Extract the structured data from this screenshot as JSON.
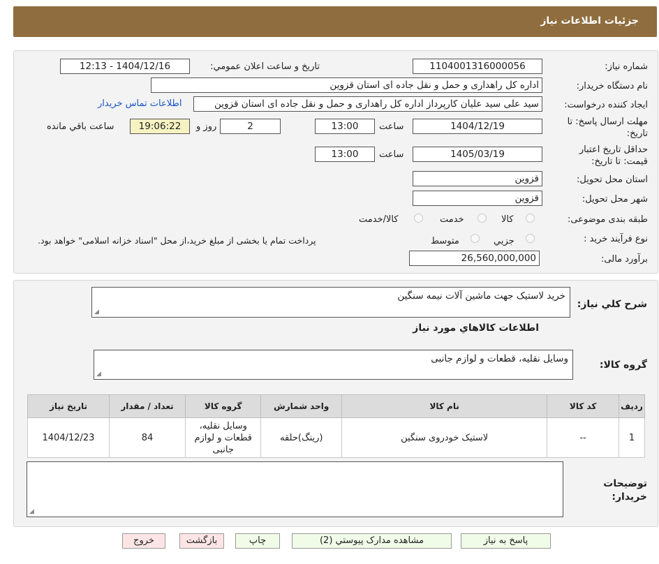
{
  "header": {
    "title": "جزئیات اطلاعات نیاز"
  },
  "form": {
    "need_number_label": "شماره نیاز:",
    "need_number": "1104001316000056",
    "announce_label": "تاریخ و ساعت اعلان عمومي:",
    "announce_value": "1404/12/16 - 12:13",
    "buyer_org_label": "نام دستگاه خريدار:",
    "buyer_org": "اداره کل راهداری و حمل و نقل جاده ای استان قزوین",
    "requester_label": "ايجاد کننده درخواست:",
    "requester": "سید علی سید علیان کارپرداز اداره کل راهداری و حمل و نقل جاده ای استان قزوین",
    "contact_link": "اطلاعات تماس خريدار",
    "deadline_label": "مهلت ارسال پاسخ: تا تاریخ:",
    "deadline_date": "1404/12/19",
    "time_label": "ساعت",
    "deadline_time": "13:00",
    "days": "2",
    "days_label": "روز و",
    "remaining_time": "19:06:22",
    "remaining_label": "ساعت باقي مانده",
    "validity_label": "حداقل تاريخ اعتبار قيمت: تا تاریخ:",
    "validity_date": "1405/03/19",
    "validity_time": "13:00",
    "province_label": "استان محل تحويل:",
    "province": "قزوين",
    "city_label": "شهر محل تحويل:",
    "city": "قزوين",
    "category_label": "طبقه بندی موضوعی:",
    "category_options": [
      "کالا",
      "خدمت",
      "کالا/خدمت"
    ],
    "process_label": "نوع فرآيند خريد :",
    "process_options": [
      "جزيي",
      "متوسط"
    ],
    "process_note": "پرداخت تمام یا بخشی از مبلغ خرید،از محل \"اسناد خزانه اسلامی\" خواهد بود.",
    "budget_label": "برآورد مالی:",
    "budget": "26,560,000,000"
  },
  "description": {
    "label": "شرح کلي نياز:",
    "value": "خرید لاستیک جهت ماشین آلات نیمه سنگین"
  },
  "goods": {
    "section_title": "اطلاعات کالاهاي مورد نياز",
    "group_label": "گروه کالا:",
    "group_value": "وسایل نقلیه، قطعات و لوازم جانبی",
    "columns": [
      "رديف",
      "کد کالا",
      "نام کالا",
      "واحد شمارش",
      "گروه کالا",
      "تعداد / مقدار",
      "تاريخ نياز"
    ],
    "rows": [
      [
        "1",
        "--",
        "لاستیک خودروی سنگین",
        "(رینگ)حلقه",
        "وسایل نقلیه، قطعات و لوازم جانبی",
        "84",
        "1404/12/23"
      ]
    ]
  },
  "notes": {
    "label": "توضيحات خريدار:",
    "value": ""
  },
  "buttons": {
    "reply": "پاسخ به نياز",
    "attachments": "مشاهده مدارک پيوستي (2)",
    "print": "چاپ",
    "back": "بازگشت",
    "exit": "خروج"
  },
  "colors": {
    "header_bg": "#8f6d3e",
    "remaining_bg": "#f6f2c2",
    "link": "#1a55c9"
  }
}
